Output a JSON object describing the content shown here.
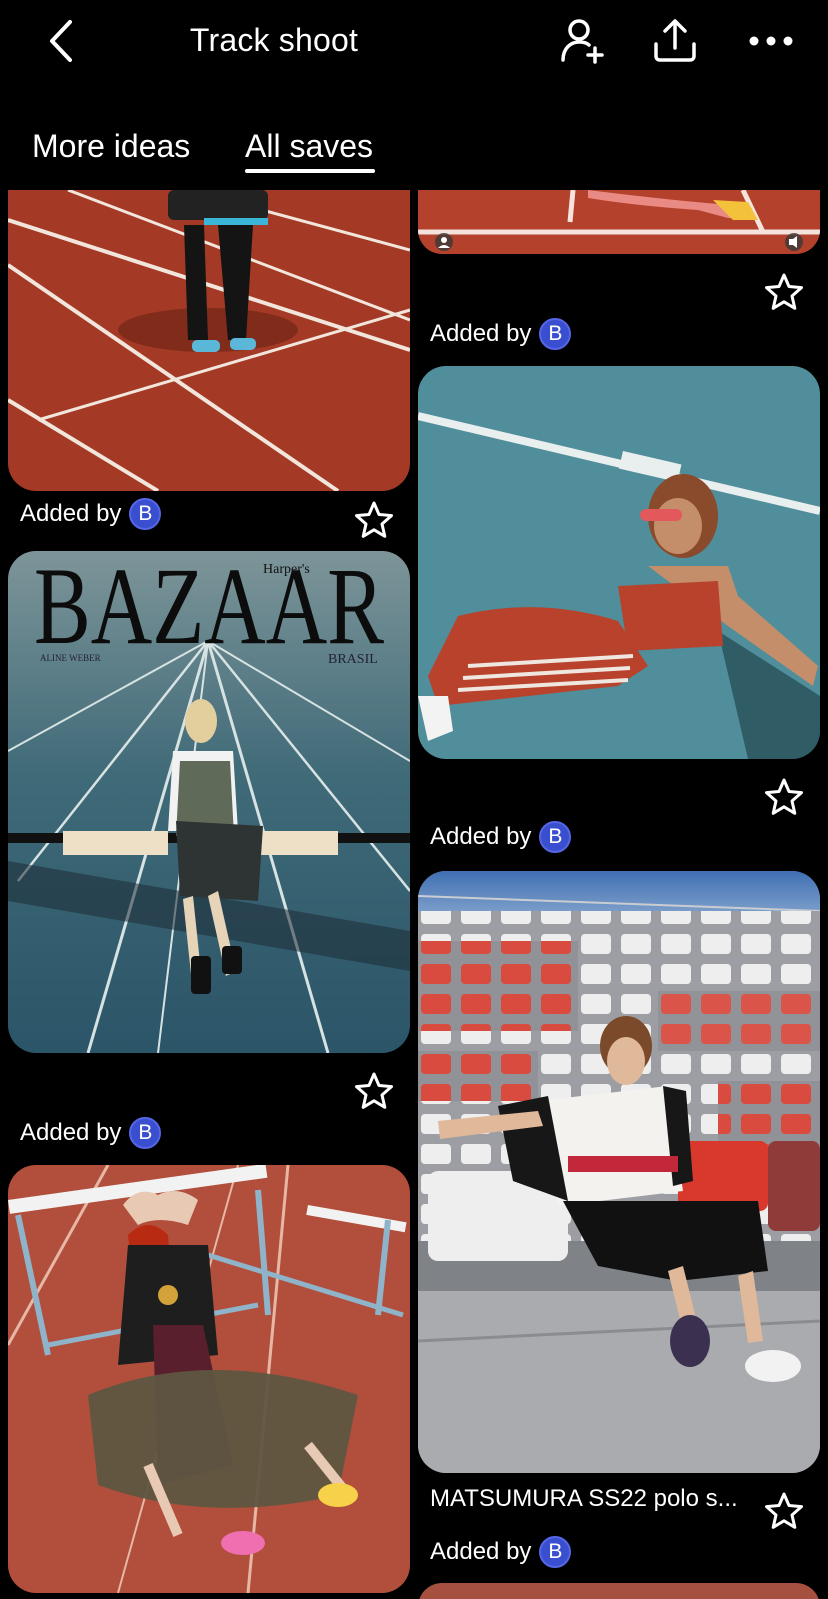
{
  "header": {
    "title": "Track shoot",
    "back_icon": "chevron-left-icon",
    "invite_icon": "add-collaborator-icon",
    "share_icon": "share-upload-icon",
    "more_icon": "more-horizontal-icon"
  },
  "tabs": [
    {
      "label": "More ideas",
      "active": false
    },
    {
      "label": "All saves",
      "active": true
    }
  ],
  "pins": {
    "left": [
      {
        "added_by_label": "Added by",
        "avatar_letter": "B"
      },
      {
        "added_by_label": "Added by",
        "avatar_letter": "B",
        "magazine_title": "BAZAAR",
        "magazine_subtitle": "Harper's",
        "magazine_edition": "BRASIL",
        "magazine_credit": "ALINE WEBER"
      },
      {}
    ],
    "right": [
      {
        "added_by_label": "Added by",
        "avatar_letter": "B"
      },
      {
        "added_by_label": "Added by",
        "avatar_letter": "B"
      },
      {
        "caption": "MATSUMURA SS22 polo s...",
        "added_by_label": "Added by",
        "avatar_letter": "B"
      }
    ]
  },
  "colors": {
    "background": "#000000",
    "avatar": "#3a4fd0",
    "track_red": "#a43a25",
    "track_blue": "#4d8a97"
  }
}
